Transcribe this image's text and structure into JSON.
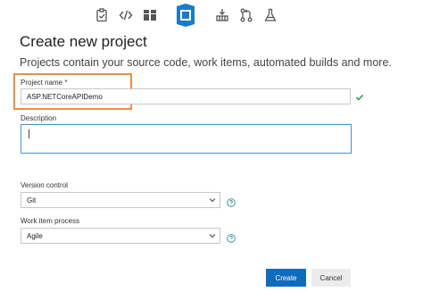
{
  "toolbar": {
    "icons": [
      "clipboard-check-icon",
      "code-icon",
      "package-icon",
      "visual-studio-logo-icon",
      "build-icon",
      "pull-request-icon",
      "flask-icon"
    ]
  },
  "page": {
    "title": "Create new project",
    "subtitle": "Projects contain your source code, work items, automated builds and more."
  },
  "form": {
    "project_name_label": "Project name *",
    "project_name_value": "ASP.NETCoreAPIDemo",
    "description_label": "Description",
    "description_value": "",
    "version_control_label": "Version control",
    "version_control_value": "Git",
    "work_item_process_label": "Work item process",
    "work_item_process_value": "Agile"
  },
  "actions": {
    "create_label": "Create",
    "cancel_label": "Cancel"
  },
  "colors": {
    "accent": "#0f6cbd",
    "highlight": "#ee8e3d",
    "success": "#2e9f3e"
  }
}
